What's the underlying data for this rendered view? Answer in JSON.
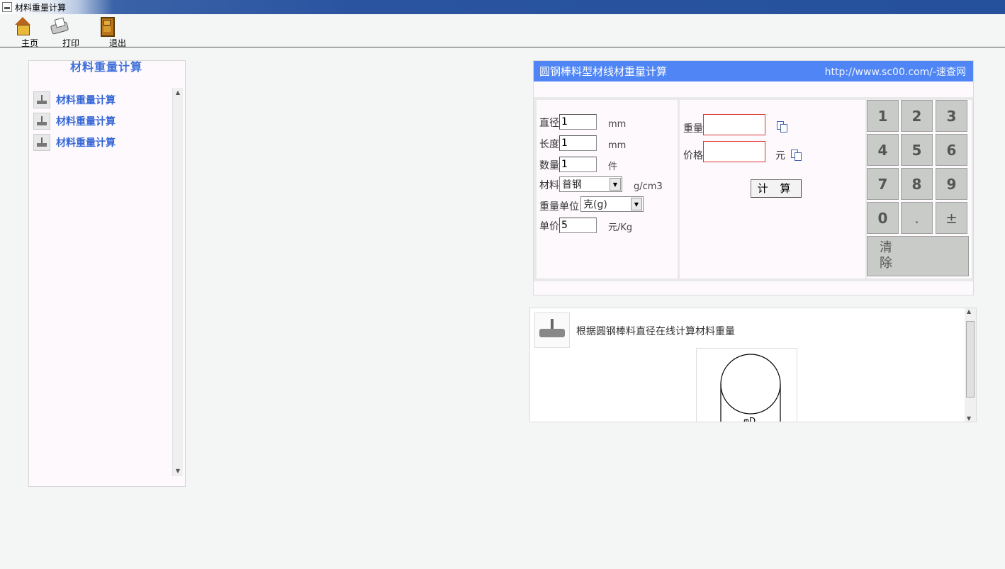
{
  "window": {
    "title": "材料重量计算"
  },
  "toolbar": {
    "home_label": "主页",
    "print_label": "打印",
    "exit_label": "退出"
  },
  "left_panel": {
    "title": "材料重量计算",
    "items": [
      {
        "label": "材料重量计算",
        "icon": "scale-icon"
      },
      {
        "label": "材料重量计算",
        "icon": "scale-icon"
      },
      {
        "label": "材料重量计算",
        "icon": "scale-icon"
      }
    ]
  },
  "calculator": {
    "title": "圆钢棒料型材线材重量计算",
    "url": "http://www.sc00.com/-速查网",
    "header_color": "#4f85f4",
    "fields": {
      "diameter": {
        "label": "直径",
        "value": "1",
        "unit": "mm"
      },
      "length": {
        "label": "长度",
        "value": "1",
        "unit": "mm"
      },
      "quantity": {
        "label": "数量",
        "value": "1",
        "unit": "件"
      },
      "material": {
        "label": "材料",
        "selected": "普钢",
        "unit": "g/cm3"
      },
      "weight_unit": {
        "label": "重量单位",
        "selected": "克(g)"
      },
      "unit_price": {
        "label": "单价",
        "value": "5",
        "unit": "元/Kg"
      }
    },
    "results": {
      "weight_label": "重量",
      "weight_value": "",
      "price_label": "价格",
      "price_value": "",
      "price_unit": "元"
    },
    "calculate_label": "计 算",
    "keypad": [
      "1",
      "2",
      "3",
      "4",
      "5",
      "6",
      "7",
      "8",
      "9",
      "0",
      ".",
      "±"
    ],
    "clear_label_line1": "清",
    "clear_label_line2": "除"
  },
  "description": {
    "text": "根据圆钢棒料直径在线计算材料重量",
    "diagram_label": "φD"
  }
}
